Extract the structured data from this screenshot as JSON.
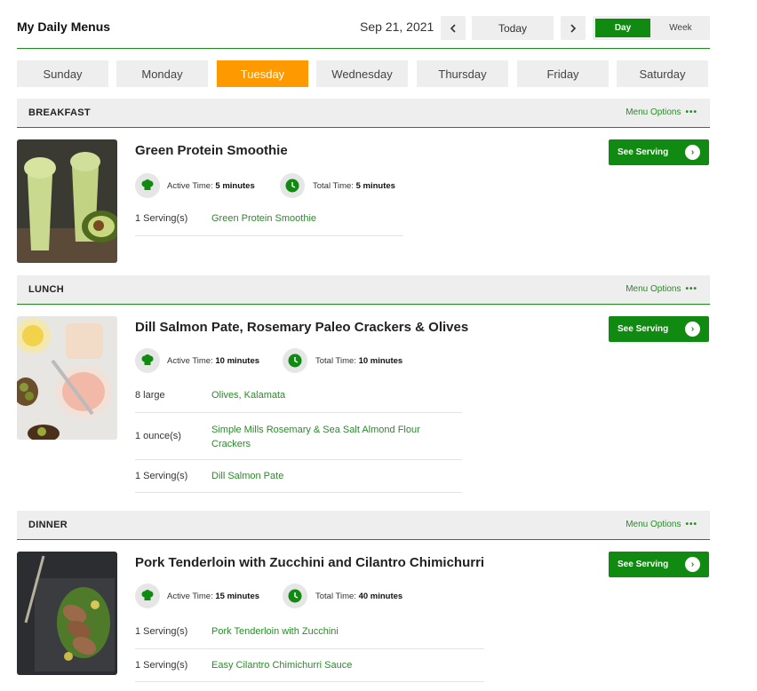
{
  "header": {
    "title": "My Daily Menus",
    "date": "Sep 21, 2021",
    "prev_icon": "chevron-left-icon",
    "next_icon": "chevron-right-icon",
    "today_label": "Today",
    "view_day": "Day",
    "view_week": "Week"
  },
  "days": [
    "Sunday",
    "Monday",
    "Tuesday",
    "Wednesday",
    "Thursday",
    "Friday",
    "Saturday"
  ],
  "active_day": "Tuesday",
  "colors": {
    "accent": "#118a11",
    "active_tab": "#ff9900",
    "bar": "#eeeeee"
  },
  "menu_options_label": "Menu Options",
  "see_serving_label": "See Serving",
  "active_time_label": "Active Time:",
  "total_time_label": "Total Time:",
  "meals": [
    {
      "name": "BREAKFAST",
      "recipe": {
        "title": "Green Protein Smoothie",
        "active_time": "5 minutes",
        "total_time": "5 minutes",
        "ingredients": [
          {
            "qty": "1 Serving(s)",
            "name": "Green Protein Smoothie"
          }
        ]
      }
    },
    {
      "name": "LUNCH",
      "recipe": {
        "title": "Dill Salmon Pate, Rosemary Paleo Crackers & Olives",
        "active_time": "10 minutes",
        "total_time": "10 minutes",
        "ingredients": [
          {
            "qty": "8 large",
            "name": "Olives, Kalamata"
          },
          {
            "qty": "1 ounce(s)",
            "name": "Simple Mills Rosemary & Sea Salt Almond Flour Crackers"
          },
          {
            "qty": "1 Serving(s)",
            "name": "Dill Salmon Pate"
          }
        ]
      }
    },
    {
      "name": "DINNER",
      "recipe": {
        "title": "Pork Tenderloin with Zucchini and Cilantro Chimichurri",
        "active_time": "15 minutes",
        "total_time": "40 minutes",
        "ingredients": [
          {
            "qty": "1 Serving(s)",
            "name": "Pork Tenderloin with Zucchini"
          },
          {
            "qty": "1 Serving(s)",
            "name": "Easy Cilantro Chimichurri Sauce"
          }
        ]
      }
    }
  ]
}
